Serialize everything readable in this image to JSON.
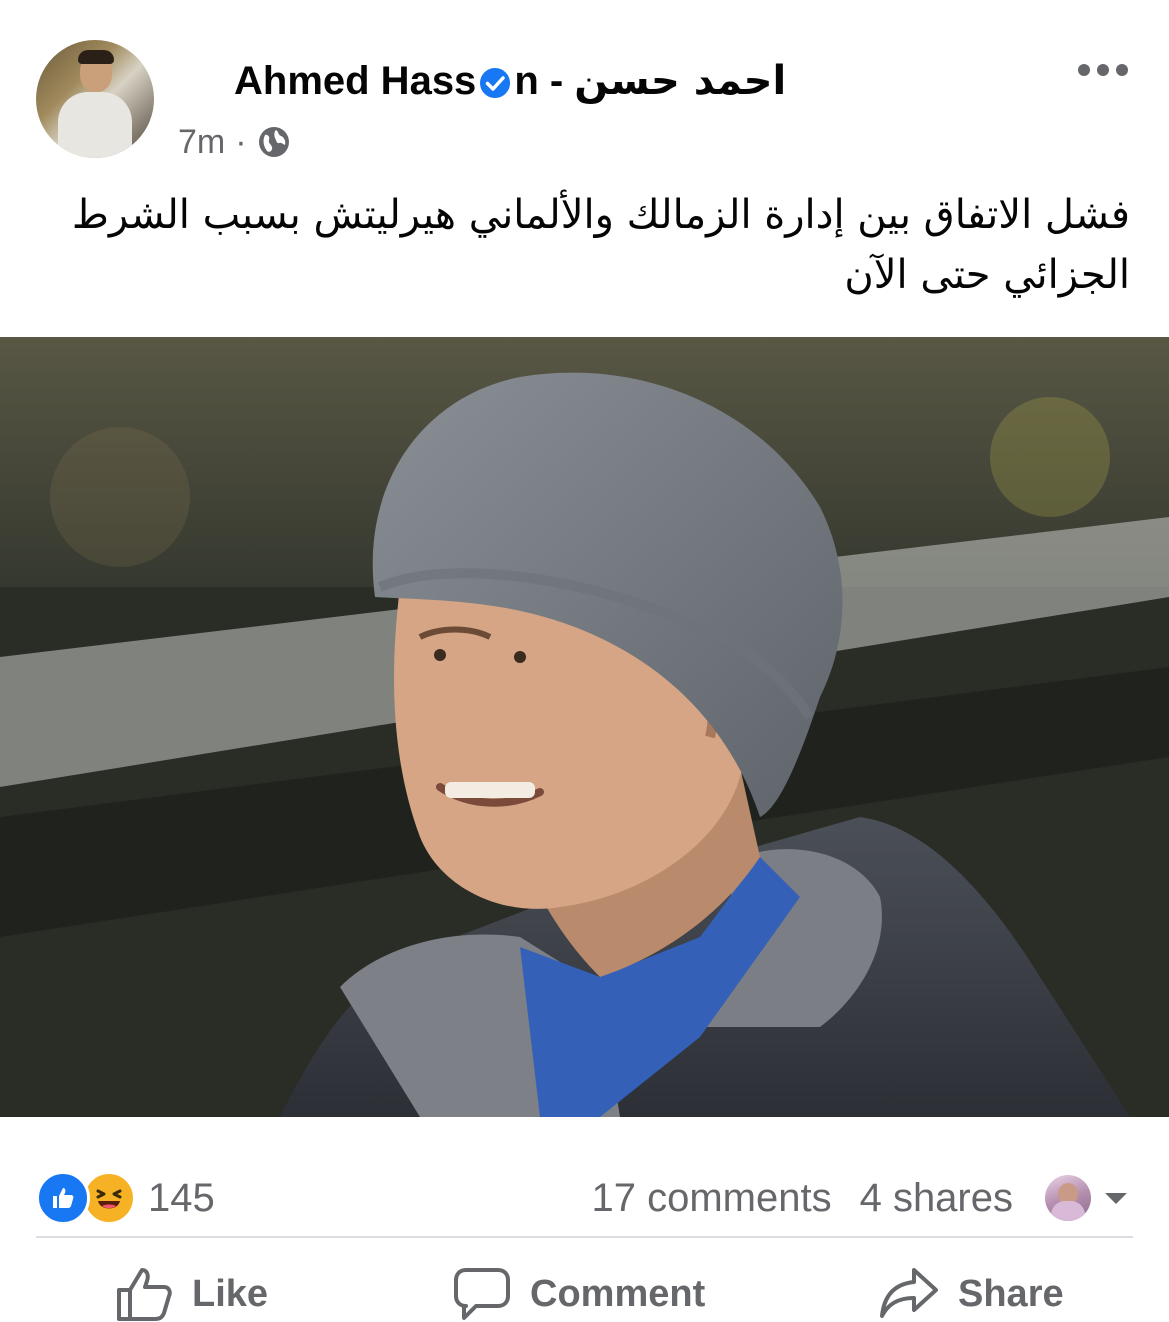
{
  "post": {
    "author_latin": "Ahmed Hass",
    "author_latin_tail": "n",
    "author_sep": " - ",
    "author_arabic": "احمد حسن",
    "time": "7m",
    "meta_sep": "·",
    "text": "فشل الاتفاق بين إدارة الزمالك والألماني هيرليتش بسبب الشرط الجزائي حتى الآن"
  },
  "stats": {
    "reaction_count": "145",
    "comments": "17 comments",
    "shares": "4 shares"
  },
  "actions": {
    "like": "Like",
    "comment": "Comment",
    "share": "Share"
  },
  "colors": {
    "text": "#050505",
    "secondary": "#65676b",
    "like_blue": "#1877f2",
    "haha_yellow": "#f7b125",
    "divider": "#dadde1"
  },
  "icons": [
    "more-options-icon",
    "verified-badge-icon",
    "globe-icon",
    "like-reaction-icon",
    "haha-reaction-icon",
    "dropdown-caret-icon",
    "like-thumb-icon",
    "comment-bubble-icon",
    "share-arrow-icon"
  ]
}
